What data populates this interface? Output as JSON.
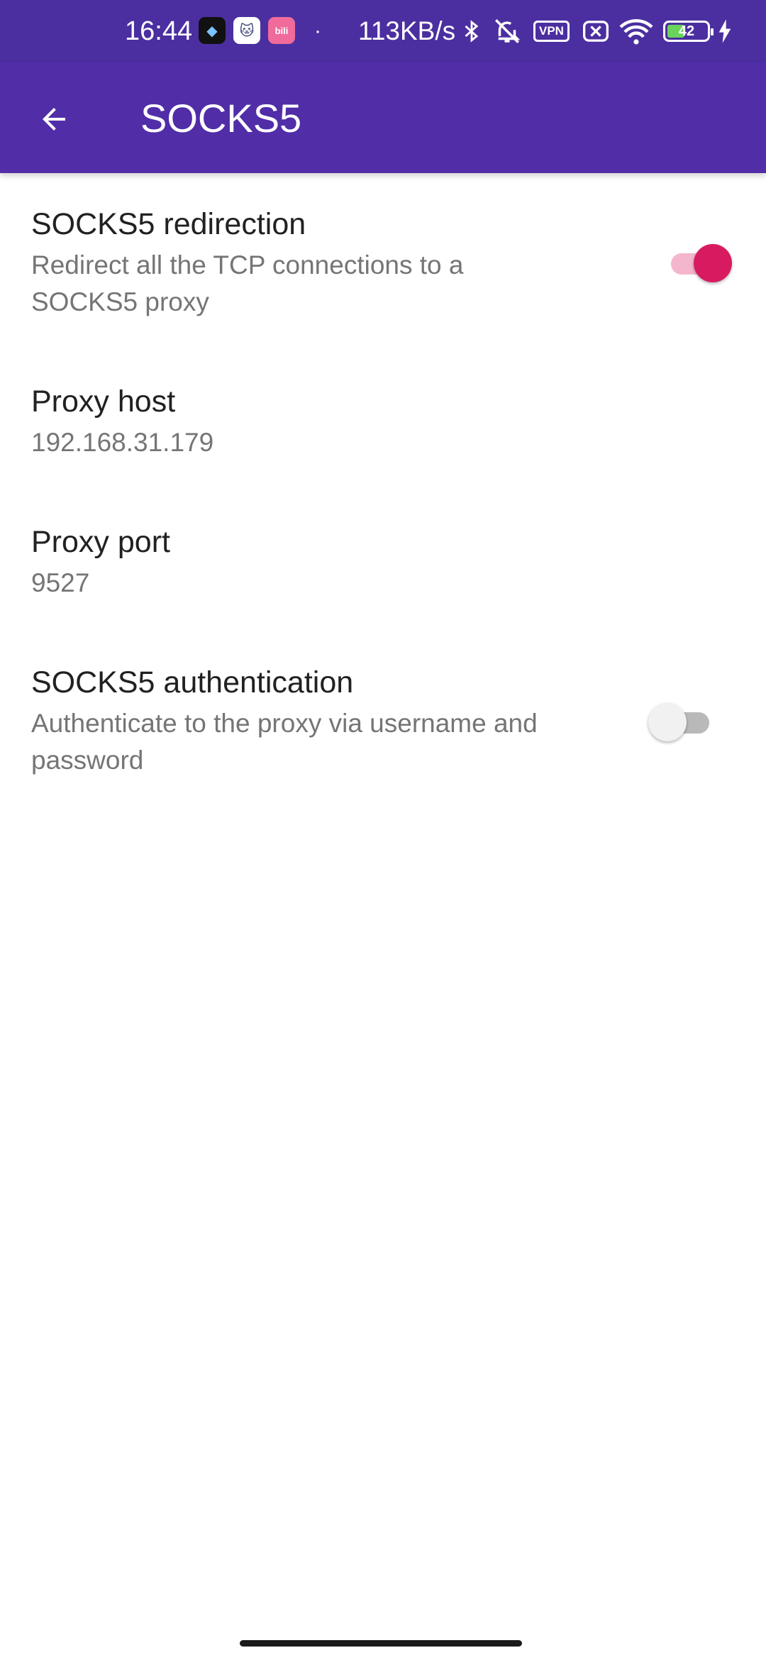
{
  "status_bar": {
    "time": "16:44",
    "net_speed": "113KB/s",
    "vpn_label": "VPN",
    "battery_level": "42",
    "icons": [
      "app-icon-1",
      "app-icon-2",
      "bilibili-icon",
      "bluetooth-icon",
      "mute-icon",
      "vpn-icon",
      "sim-error-icon",
      "wifi-icon",
      "battery-icon",
      "charging-icon"
    ]
  },
  "app_bar": {
    "title": "SOCKS5",
    "back_icon": "arrow-back-icon",
    "color": "#512da8"
  },
  "preferences": [
    {
      "title": "SOCKS5 redirection",
      "summary": "Redirect all the TCP connections to a SOCKS5 proxy",
      "toggle": true
    },
    {
      "title": "Proxy host",
      "summary": "192.168.31.179"
    },
    {
      "title": "Proxy port",
      "summary": "9527"
    },
    {
      "title": "SOCKS5 authentication",
      "summary": "Authenticate to the proxy via username and password",
      "toggle": false
    }
  ],
  "colors": {
    "accent": "#d81b60",
    "status_bar": "#4b2fa0"
  }
}
